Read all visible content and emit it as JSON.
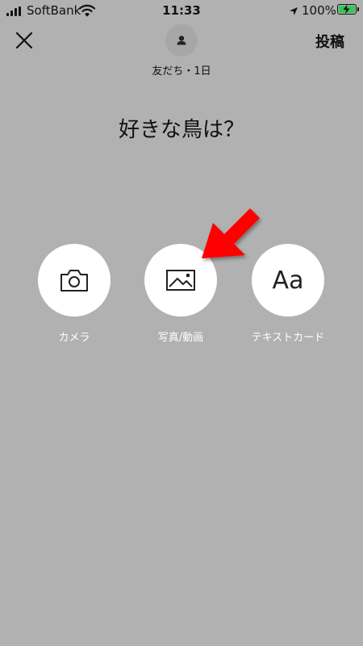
{
  "status_bar": {
    "carrier": "SoftBank",
    "time": "11:33",
    "battery_percent": "100%",
    "signal_icon": "cellular-signal-icon",
    "wifi_icon": "wifi-icon",
    "location_icon": "location-arrow-icon",
    "battery_icon": "battery-charging-icon"
  },
  "header": {
    "close_icon": "close-icon",
    "post_label": "投稿",
    "avatar_icon": "person-icon",
    "visibility_label": "友だち・1日"
  },
  "post": {
    "text": "好きな鳥は？"
  },
  "options": [
    {
      "label": "カメラ",
      "icon": "camera-icon"
    },
    {
      "label": "写真/動画",
      "icon": "image-icon"
    },
    {
      "label": "テキストカード",
      "icon": "text-card-icon",
      "glyph": "Aa"
    }
  ],
  "annotation": {
    "arrow_color": "#ff0000",
    "arrow_icon": "red-pointer-arrow"
  },
  "colors": {
    "background": "#b1b1b1",
    "battery_fill": "#35c759"
  }
}
